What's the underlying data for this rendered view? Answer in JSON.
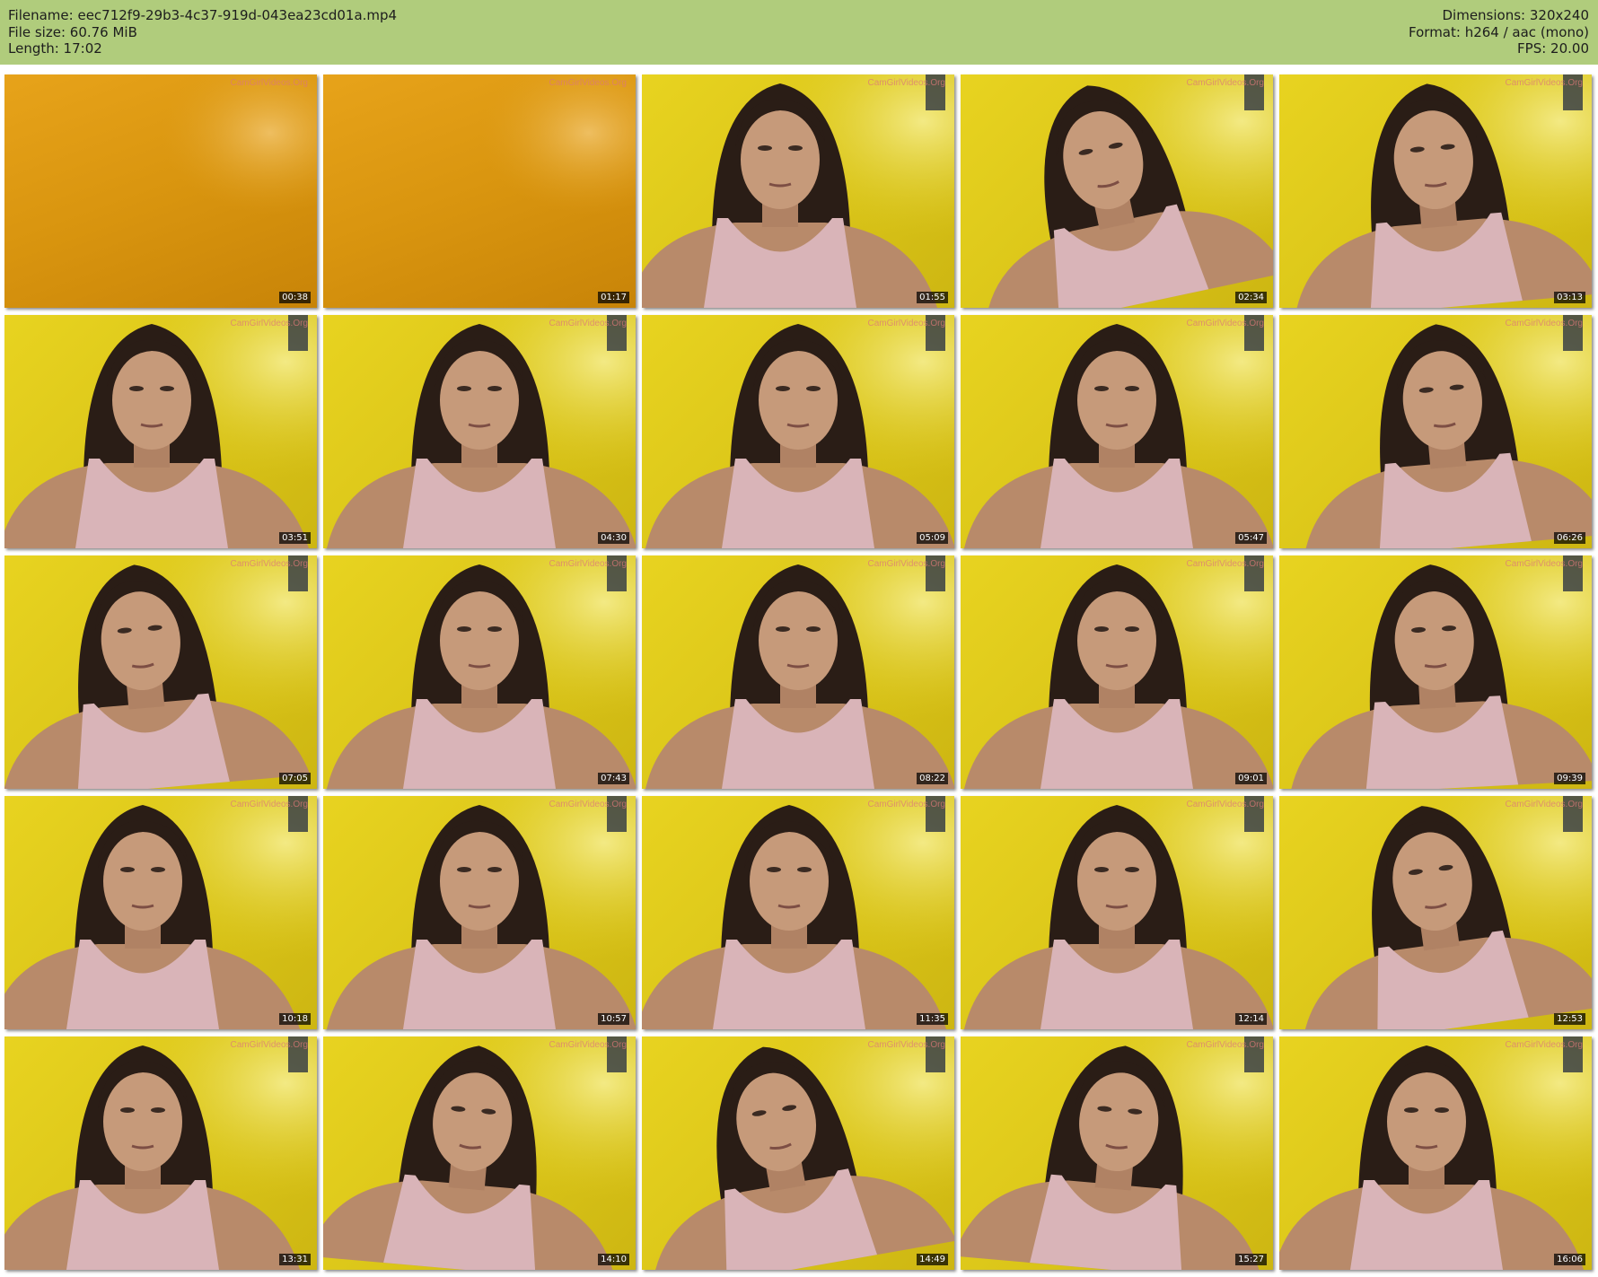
{
  "header": {
    "filename": "Filename: eec712f9-29b3-4c37-919d-043ea23cd01a.mp4",
    "filesize": "File size: 60.76 MiB",
    "length": "Length: 17:02",
    "dimensions": "Dimensions: 320x240",
    "format": "Format: h264 / aac (mono)",
    "fps": "FPS: 20.00"
  },
  "colors": {
    "header_bg": "#b0cc7c",
    "wall_yellow": "#ddc81a",
    "wall_orange": "#d9950f"
  },
  "thumbnails": [
    {
      "time": "00:38",
      "scene": "empty",
      "watermark": "CamGirlVideos.Org"
    },
    {
      "time": "01:17",
      "scene": "empty",
      "watermark": "CamGirlVideos.Org"
    },
    {
      "time": "01:55",
      "scene": "person",
      "watermark": "CamGirlVideos.Org"
    },
    {
      "time": "02:34",
      "scene": "person",
      "watermark": "CamGirlVideos.Org"
    },
    {
      "time": "03:13",
      "scene": "person",
      "watermark": "CamGirlVideos.Org"
    },
    {
      "time": "03:51",
      "scene": "person",
      "watermark": "CamGirlVideos.Org"
    },
    {
      "time": "04:30",
      "scene": "person",
      "watermark": "CamGirlVideos.Org"
    },
    {
      "time": "05:09",
      "scene": "person",
      "watermark": "CamGirlVideos.Org"
    },
    {
      "time": "05:47",
      "scene": "person",
      "watermark": "CamGirlVideos.Org"
    },
    {
      "time": "06:26",
      "scene": "person",
      "watermark": "CamGirlVideos.Org"
    },
    {
      "time": "07:05",
      "scene": "person",
      "watermark": "CamGirlVideos.Org"
    },
    {
      "time": "07:43",
      "scene": "person",
      "watermark": "CamGirlVideos.Org"
    },
    {
      "time": "08:22",
      "scene": "person",
      "watermark": "CamGirlVideos.Org"
    },
    {
      "time": "09:01",
      "scene": "person",
      "watermark": "CamGirlVideos.Org"
    },
    {
      "time": "09:39",
      "scene": "person",
      "watermark": "CamGirlVideos.Org"
    },
    {
      "time": "10:18",
      "scene": "person",
      "watermark": "CamGirlVideos.Org"
    },
    {
      "time": "10:57",
      "scene": "person",
      "watermark": "CamGirlVideos.Org"
    },
    {
      "time": "11:35",
      "scene": "person",
      "watermark": "CamGirlVideos.Org"
    },
    {
      "time": "12:14",
      "scene": "person",
      "watermark": "CamGirlVideos.Org"
    },
    {
      "time": "12:53",
      "scene": "person",
      "watermark": "CamGirlVideos.Org"
    },
    {
      "time": "13:31",
      "scene": "person",
      "watermark": "CamGirlVideos.Org"
    },
    {
      "time": "14:10",
      "scene": "person",
      "watermark": "CamGirlVideos.Org"
    },
    {
      "time": "14:49",
      "scene": "person",
      "watermark": "CamGirlVideos.Org"
    },
    {
      "time": "15:27",
      "scene": "person",
      "watermark": "CamGirlVideos.Org"
    },
    {
      "time": "16:06",
      "scene": "person",
      "watermark": "CamGirlVideos.Org"
    }
  ]
}
